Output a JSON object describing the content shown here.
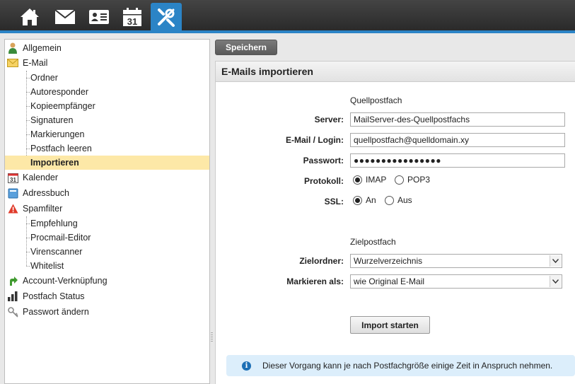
{
  "toolbar": {
    "icons": [
      "home-icon",
      "mail-icon",
      "contact-card-icon",
      "calendar-icon",
      "tools-icon"
    ],
    "calendar_day": "31",
    "active": "tools-icon",
    "accent": "#2b84c6"
  },
  "sidebar": {
    "allgemein": "Allgemein",
    "email": "E-Mail",
    "email_items": [
      "Ordner",
      "Autoresponder",
      "Kopieempfänger",
      "Signaturen",
      "Markierungen",
      "Postfach leeren",
      "Importieren"
    ],
    "selected": "Importieren",
    "kalender": "Kalender",
    "kalender_icon_day": "31",
    "adressbuch": "Adressbuch",
    "spamfilter": "Spamfilter",
    "spam_items": [
      "Empfehlung",
      "Procmail-Editor",
      "Virenscanner",
      "Whitelist"
    ],
    "account": "Account-Verknüpfung",
    "status": "Postfach Status",
    "passwort": "Passwort ändern"
  },
  "actions": {
    "save_label": "Speichern"
  },
  "form": {
    "title": "E-Mails importieren",
    "source_section": "Quellpostfach",
    "server_label": "Server:",
    "server_value": "MailServer-des-Quellpostfachs",
    "login_label": "E-Mail / Login:",
    "login_value": "quellpostfach@quelldomain.xy",
    "password_label": "Passwort:",
    "password_value": "●●●●●●●●●●●●●●●●",
    "protocol_label": "Protokoll:",
    "protocol_options": [
      "IMAP",
      "POP3"
    ],
    "protocol_selected": "IMAP",
    "ssl_label": "SSL:",
    "ssl_options": [
      "An",
      "Aus"
    ],
    "ssl_selected": "An",
    "target_section": "Zielpostfach",
    "folder_label": "Zielordner:",
    "folder_value": "Wurzelverzeichnis",
    "mark_label": "Markieren als:",
    "mark_value": "wie Original E-Mail",
    "import_button": "Import starten",
    "info_text": "Dieser Vorgang kann je nach Postfachgröße einige Zeit in Anspruch nehmen."
  }
}
